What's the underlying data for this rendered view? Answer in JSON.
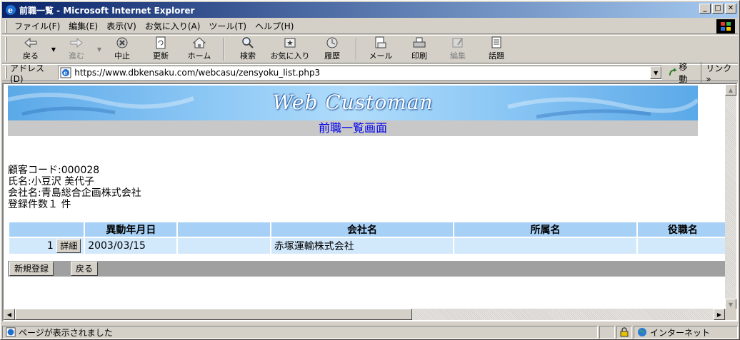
{
  "window": {
    "title": "前職一覧 - Microsoft Internet Explorer"
  },
  "menu": [
    "ファイル(F)",
    "編集(E)",
    "表示(V)",
    "お気に入り(A)",
    "ツール(T)",
    "ヘルプ(H)"
  ],
  "toolbar": {
    "back": "戻る",
    "forward": "進む",
    "stop": "中止",
    "refresh": "更新",
    "home": "ホーム",
    "search": "検索",
    "favorites": "お気に入り",
    "history": "履歴",
    "mail": "メール",
    "print": "印刷",
    "edit": "編集",
    "discuss": "話題"
  },
  "address": {
    "label": "アドレス(D)",
    "url": "https://www.dbkensaku.com/webcasu/zensyoku_list.php3",
    "go": "移動",
    "links": "リンク »"
  },
  "page": {
    "banner_title": "Web Customan",
    "banner_subtitle": "前職一覧画面",
    "customer_code": "顧客コード:000028",
    "name": "氏名:小豆沢 美代子",
    "company": "会社名:青島総合企画株式会社",
    "count": "登録件数１ 件"
  },
  "table": {
    "headers": [
      "",
      "異動年月日",
      "",
      "会社名",
      "所属名",
      "役職名"
    ],
    "rows": [
      {
        "no": "1",
        "detail": "詳細",
        "date": "2003/03/15",
        "blank": "",
        "company": "赤塚運輸株式会社",
        "dept": "",
        "title": ""
      }
    ]
  },
  "actions": {
    "new": "新規登録",
    "back": "戻る"
  },
  "status": {
    "text": "ページが表示されました",
    "zone": "インターネット"
  },
  "colors": {
    "titlebar": "#0a246a",
    "header_cell": "#a6d0f5",
    "data_cell": "#d2e8fb",
    "link": "#0000ee"
  }
}
